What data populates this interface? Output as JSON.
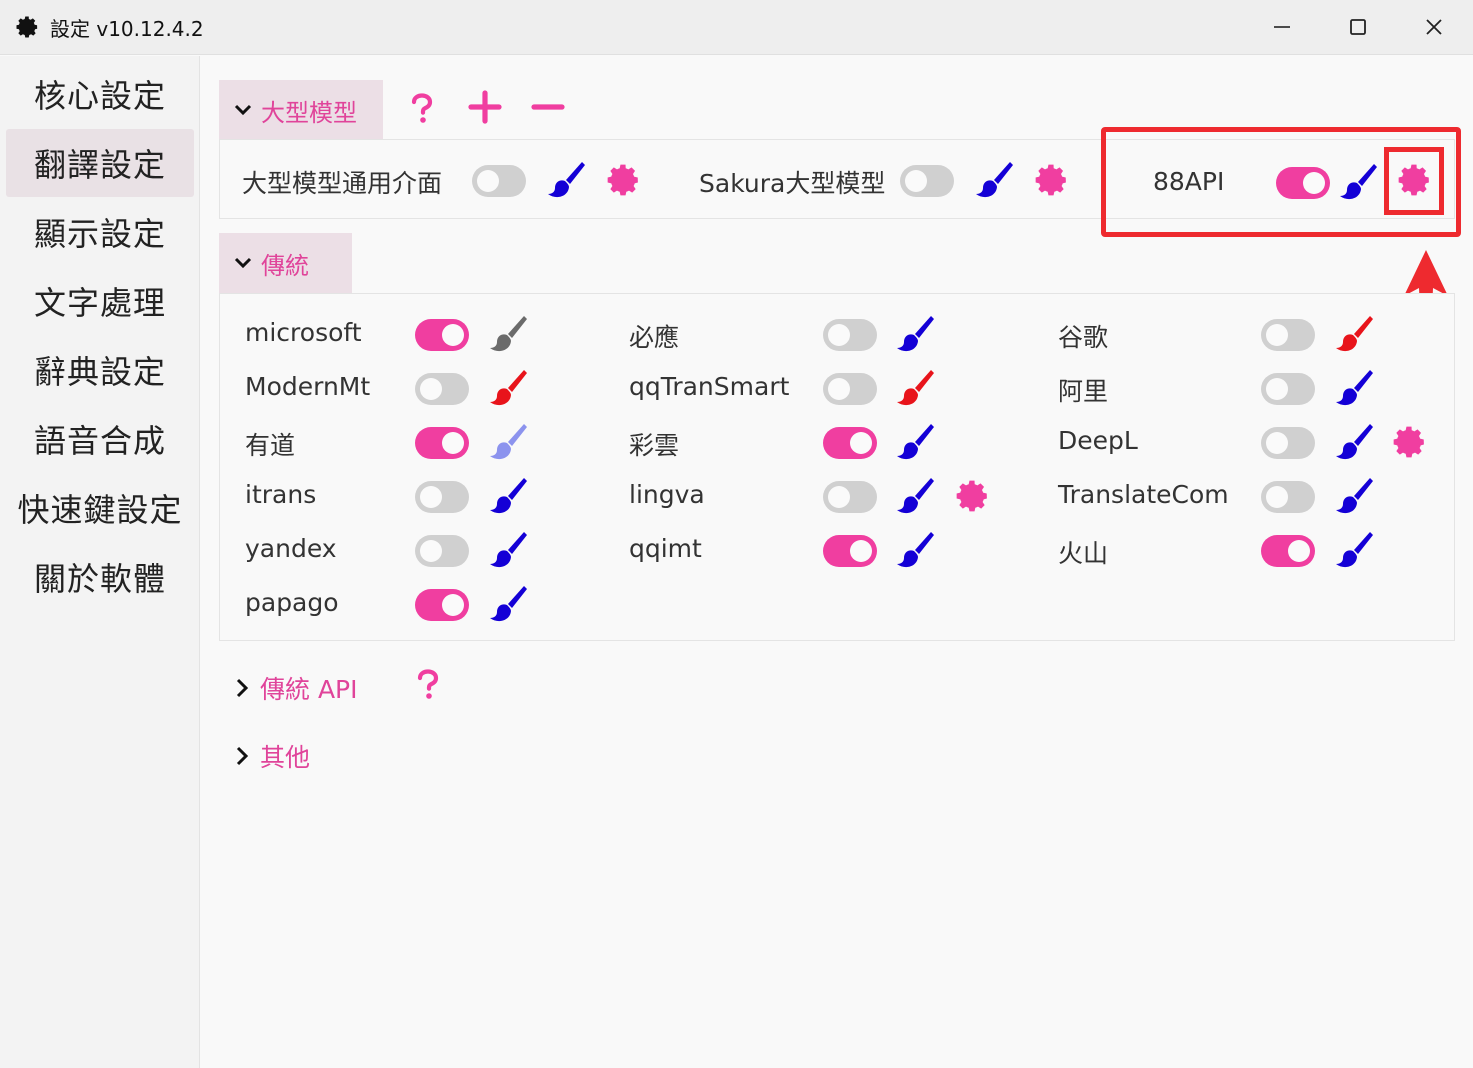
{
  "window": {
    "title": "設定 v10.12.4.2",
    "icons": [
      "gear-icon",
      "minimize-icon",
      "maximize-icon",
      "close-icon"
    ]
  },
  "sidebar": {
    "items": [
      {
        "label": "核心設定",
        "active": false
      },
      {
        "label": "翻譯設定",
        "active": true
      },
      {
        "label": "顯示設定",
        "active": false
      },
      {
        "label": "文字處理",
        "active": false
      },
      {
        "label": "辭典設定",
        "active": false
      },
      {
        "label": "語音合成",
        "active": false
      },
      {
        "label": "快速鍵設定",
        "active": false
      },
      {
        "label": "關於軟體",
        "active": false
      }
    ]
  },
  "sections": {
    "llm": {
      "title": "大型模型",
      "actions": [
        "help-icon",
        "plus-icon",
        "minus-icon"
      ],
      "items": [
        {
          "label": "大型模型通用介面",
          "enabled": false,
          "brush_color": "#1400d6",
          "settings": true
        },
        {
          "label": "Sakura大型模型",
          "enabled": false,
          "brush_color": "#1400d6",
          "settings": true
        },
        {
          "label": "88API",
          "enabled": true,
          "brush_color": "#1400d6",
          "settings": true,
          "highlighted": true
        }
      ]
    },
    "traditional": {
      "title": "傳統",
      "items": [
        {
          "label": "microsoft",
          "enabled": true,
          "brush_color": "#6b6b6b"
        },
        {
          "label": "必應",
          "enabled": false,
          "brush_color": "#1400d6"
        },
        {
          "label": "谷歌",
          "enabled": false,
          "brush_color": "#e8141b"
        },
        {
          "label": "ModernMt",
          "enabled": false,
          "brush_color": "#e8141b"
        },
        {
          "label": "qqTranSmart",
          "enabled": false,
          "brush_color": "#e8141b"
        },
        {
          "label": "阿里",
          "enabled": false,
          "brush_color": "#1400d6"
        },
        {
          "label": "有道",
          "enabled": true,
          "brush_color": "#8c93ee"
        },
        {
          "label": "彩雲",
          "enabled": true,
          "brush_color": "#1400d6"
        },
        {
          "label": "DeepL",
          "enabled": false,
          "brush_color": "#1400d6",
          "settings": true
        },
        {
          "label": "itrans",
          "enabled": false,
          "brush_color": "#1400d6"
        },
        {
          "label": "lingva",
          "enabled": false,
          "brush_color": "#1400d6",
          "settings": true
        },
        {
          "label": "TranslateCom",
          "enabled": false,
          "brush_color": "#1400d6"
        },
        {
          "label": "yandex",
          "enabled": false,
          "brush_color": "#1400d6"
        },
        {
          "label": "qqimt",
          "enabled": true,
          "brush_color": "#1400d6"
        },
        {
          "label": "火山",
          "enabled": true,
          "brush_color": "#1400d6"
        },
        {
          "label": "papago",
          "enabled": true,
          "brush_color": "#1400d6"
        }
      ]
    },
    "traditional_api": {
      "title": "傳統  API",
      "action": "help-icon"
    },
    "other": {
      "title": "其他"
    }
  },
  "colors": {
    "accent": "#e0449a",
    "toggle_on": "#f03ea0",
    "toggle_off": "#d0d0d0",
    "highlight": "#ee2a2f"
  }
}
